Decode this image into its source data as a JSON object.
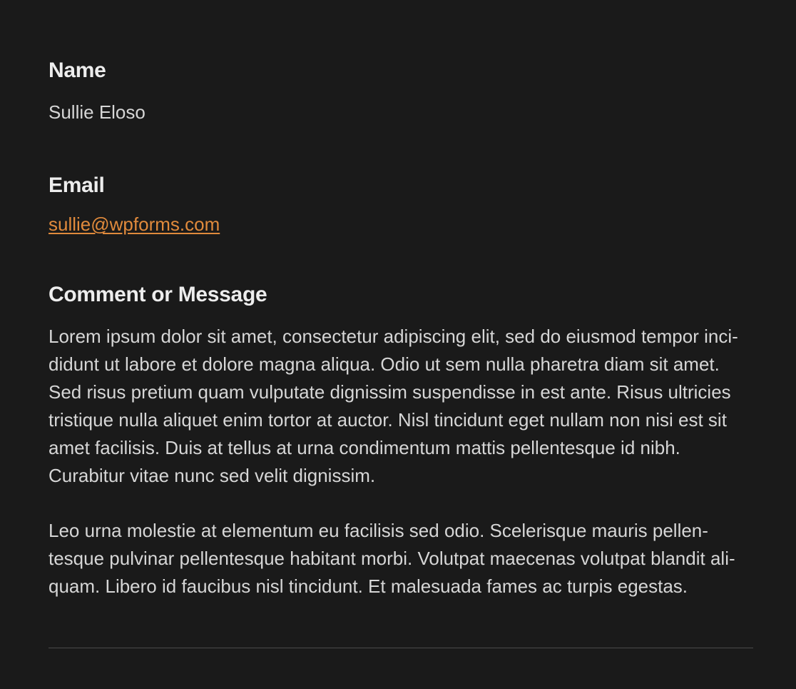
{
  "fields": {
    "name": {
      "label": "Name",
      "value": "Sullie Eloso"
    },
    "email": {
      "label": "Email",
      "value": "sullie@wpforms.com"
    },
    "message": {
      "label": "Comment or Message",
      "paragraphs": [
        "Lorem ipsum dolor sit amet, consectetur adipiscing elit, sed do eiusmod tempor inci-didunt ut labore et dolore magna aliqua. Odio ut sem nulla pharetra diam sit amet. Sed risus pretium quam vulputate dignissim suspendisse in est ante. Risus ultricies tristique nulla aliquet enim tortor at auctor. Nisl tincidunt eget nullam non nisi est sit amet facilisis. Duis at tellus at urna condimentum mattis pellentesque id nibh. Curabitur vitae nunc sed velit dignissim.",
        "Leo urna molestie at elementum eu facilisis sed odio. Scelerisque mauris pellen-tesque pulvinar pellentesque habitant morbi. Volutpat maecenas volutpat blandit ali-quam. Libero id faucibus nisl tincidunt. Et malesuada fames ac turpis egestas."
      ]
    }
  }
}
